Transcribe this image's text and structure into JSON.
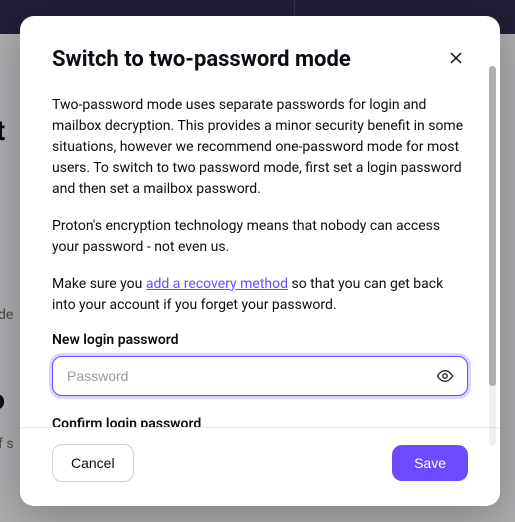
{
  "modal": {
    "title": "Switch to two-password mode",
    "paragraph1": "Two-password mode uses separate passwords for login and mailbox decryption. This provides a minor security benefit in some situations, however we recommend one-password mode for most users. To switch to two password mode, first set a login password and then set a mailbox password.",
    "paragraph2": "Proton's encryption technology means that nobody can access your password - not even us.",
    "paragraph3_prefix": "Make sure you ",
    "paragraph3_link": "add a recovery method",
    "paragraph3_suffix": " so that you can get back into your account if you forget your password.",
    "new_password_label": "New login password",
    "confirm_password_label": "Confirm login password",
    "password_placeholder": "Password",
    "cancel_label": "Cancel",
    "save_label": "Save"
  },
  "background": {
    "heading_fragment1": "nt",
    "text_fragment": "ode",
    "text_fragment2": "of s",
    "heading_fragment2": "to"
  }
}
